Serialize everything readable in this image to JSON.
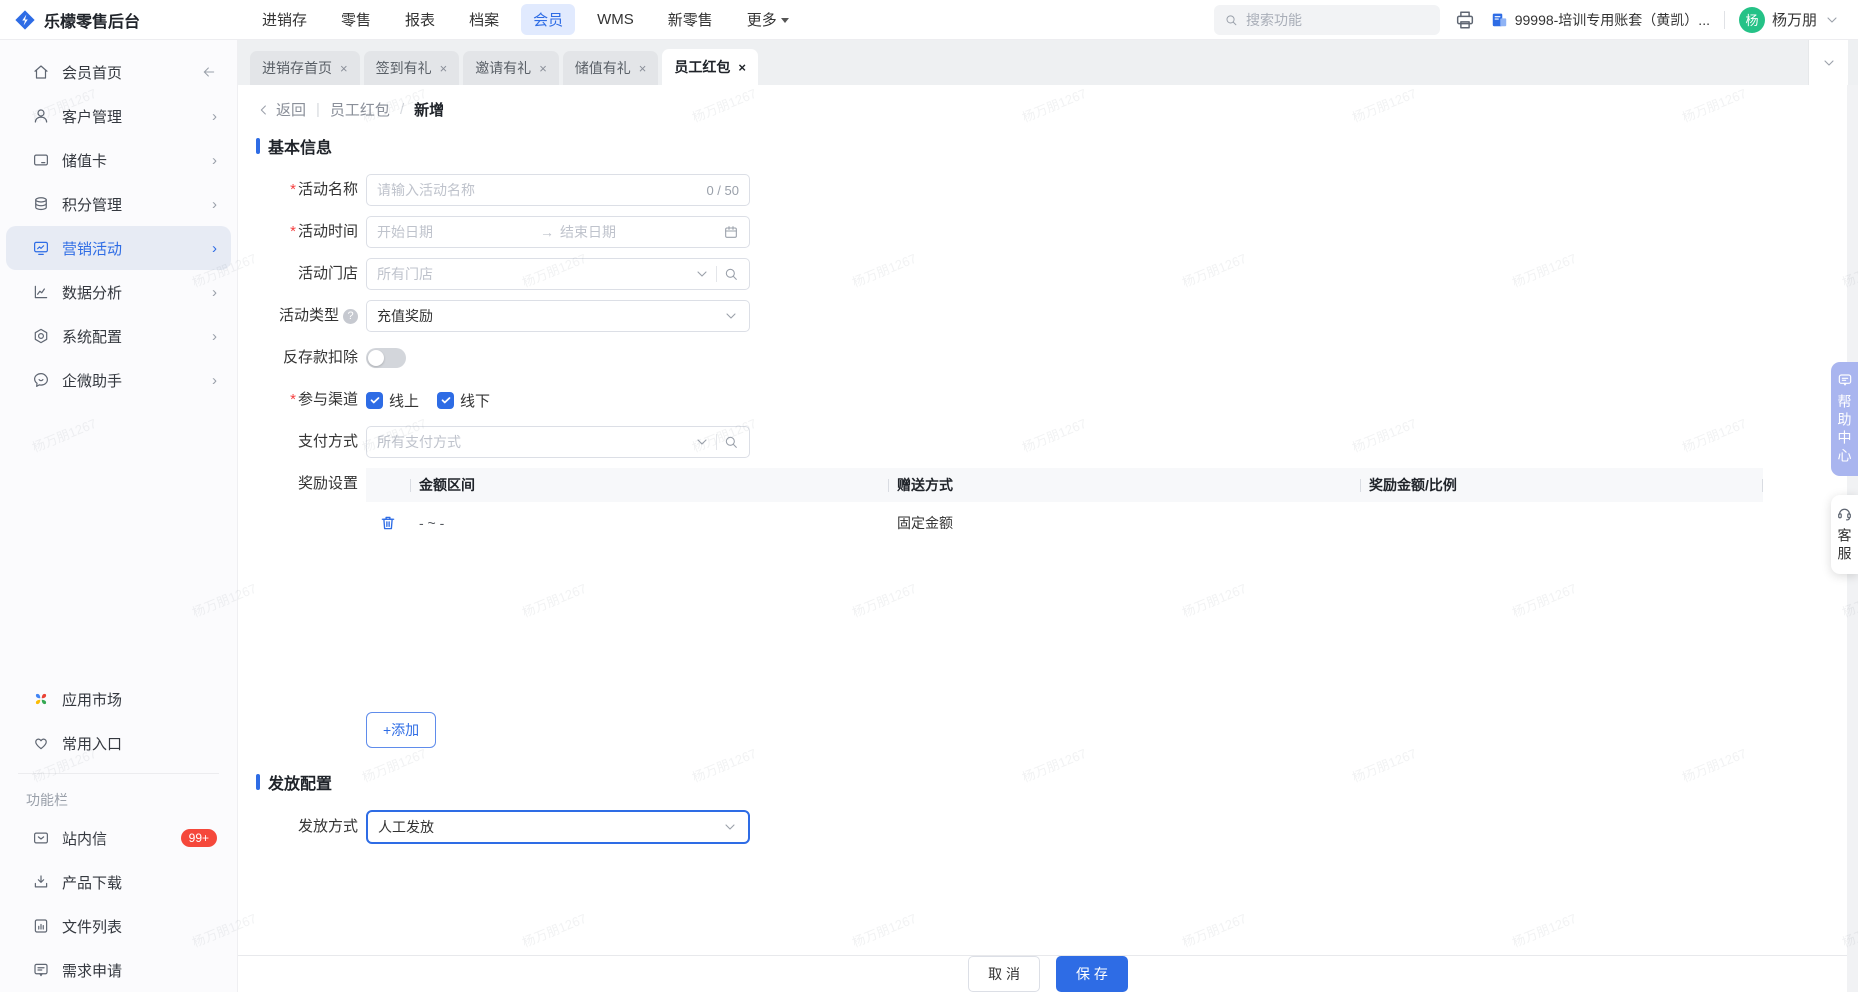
{
  "navbar": {
    "logo_text": "乐檬零售后台",
    "menu": [
      {
        "label": "进销存"
      },
      {
        "label": "零售"
      },
      {
        "label": "报表"
      },
      {
        "label": "档案"
      },
      {
        "label": "会员"
      },
      {
        "label": "WMS"
      },
      {
        "label": "新零售"
      },
      {
        "label": "更多"
      }
    ],
    "search_placeholder": "搜索功能",
    "account_label": "99998-培训专用账套（黄凯）...",
    "avatar_initial": "杨",
    "username": "杨万朋"
  },
  "sidebar": {
    "items": [
      {
        "label": "会员首页"
      },
      {
        "label": "客户管理"
      },
      {
        "label": "储值卡"
      },
      {
        "label": "积分管理"
      },
      {
        "label": "营销活动"
      },
      {
        "label": "数据分析"
      },
      {
        "label": "系统配置"
      },
      {
        "label": "企微助手"
      }
    ],
    "secondary": [
      {
        "label": "应用市场"
      },
      {
        "label": "常用入口"
      }
    ],
    "section_label": "功能栏",
    "tools": [
      {
        "label": "站内信",
        "badge": "99+"
      },
      {
        "label": "产品下载"
      },
      {
        "label": "文件列表"
      },
      {
        "label": "需求申请"
      }
    ]
  },
  "tabs": {
    "close_glyph": "×",
    "items": [
      {
        "label": "进销存首页"
      },
      {
        "label": "签到有礼"
      },
      {
        "label": "邀请有礼"
      },
      {
        "label": "储值有礼"
      },
      {
        "label": "员工红包"
      }
    ]
  },
  "breadcrumb": {
    "back": "返回",
    "parent": "员工红包",
    "divider": "/",
    "current": "新增"
  },
  "form": {
    "section_basic": "基本信息",
    "activity_name": {
      "label": "活动名称",
      "placeholder": "请输入活动名称",
      "counter": "0 / 50"
    },
    "activity_time": {
      "label": "活动时间",
      "start_placeholder": "开始日期",
      "end_placeholder": "结束日期"
    },
    "activity_store": {
      "label": "活动门店",
      "value": "所有门店"
    },
    "activity_type": {
      "label": "活动类型",
      "value": "充值奖励"
    },
    "deduct": {
      "label": "反存款扣除"
    },
    "channels": {
      "label": "参与渠道",
      "options": [
        {
          "label": "线上"
        },
        {
          "label": "线下"
        }
      ]
    },
    "payment": {
      "label": "支付方式",
      "value": "所有支付方式"
    },
    "reward": {
      "label": "奖励设置"
    },
    "add_button": "+添加",
    "section_delivery": "发放配置",
    "delivery": {
      "label": "发放方式",
      "value": "人工发放"
    }
  },
  "reward_table": {
    "headers": [
      {
        "label": "金额区间"
      },
      {
        "label": "赠送方式"
      },
      {
        "label": "奖励金额/比例"
      }
    ],
    "row": {
      "amount_range": "- ~ -",
      "gift_method": "固定金额",
      "reward_amount": ""
    }
  },
  "footer": {
    "cancel": "取 消",
    "save": "保 存"
  },
  "floating": {
    "help": "帮助中心",
    "service": "客服"
  },
  "watermark": {
    "text": "杨万朋1267"
  }
}
